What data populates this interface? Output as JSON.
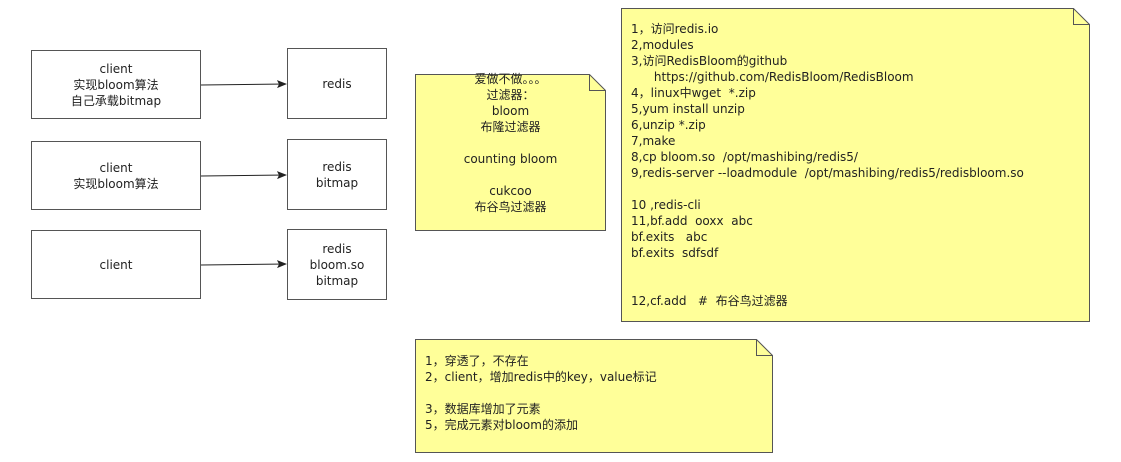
{
  "diagram": {
    "clients": [
      {
        "lines": [
          "client",
          "实现bloom算法",
          "自己承载bitmap"
        ]
      },
      {
        "lines": [
          "client",
          "实现bloom算法"
        ]
      },
      {
        "lines": [
          "client"
        ]
      }
    ],
    "servers": [
      {
        "lines": [
          "redis"
        ]
      },
      {
        "lines": [
          "redis",
          "bitmap"
        ]
      },
      {
        "lines": [
          "redis",
          "bloom.so",
          "bitmap"
        ]
      }
    ],
    "filters_note": {
      "lines": [
        "爱做不做。。。",
        "过滤器：",
        "bloom",
        "布隆过滤器",
        "",
        "counting bloom",
        "",
        "cukcoo",
        "布谷鸟过滤器"
      ]
    },
    "steps_note": {
      "lines": [
        "1，访问redis.io",
        "2,modules",
        "3,访问RedisBloom的github",
        "      https://github.com/RedisBloom/RedisBloom",
        "4，linux中wget  *.zip",
        "5,yum install unzip",
        "6,unzip *.zip",
        "7,make",
        "8,cp bloom.so  /opt/mashibing/redis5/",
        "9,redis-server --loadmodule  /opt/mashibing/redis5/redisbloom.so",
        "",
        "10 ,redis-cli",
        "11,bf.add  ooxx  abc",
        "bf.exits   abc",
        "bf.exits  sdfsdf",
        "",
        "",
        "12,cf.add   #  布谷鸟过滤器"
      ]
    },
    "flow_note": {
      "lines": [
        "1，穿透了，不存在",
        "2，client，增加redis中的key，value标记",
        "",
        "3，数据库增加了元素",
        "5，完成元素对bloom的添加"
      ]
    },
    "colors": {
      "note_fill": "#ffff99",
      "note_border": "#555555",
      "box_border": "#555555",
      "arrow": "#222222"
    }
  }
}
